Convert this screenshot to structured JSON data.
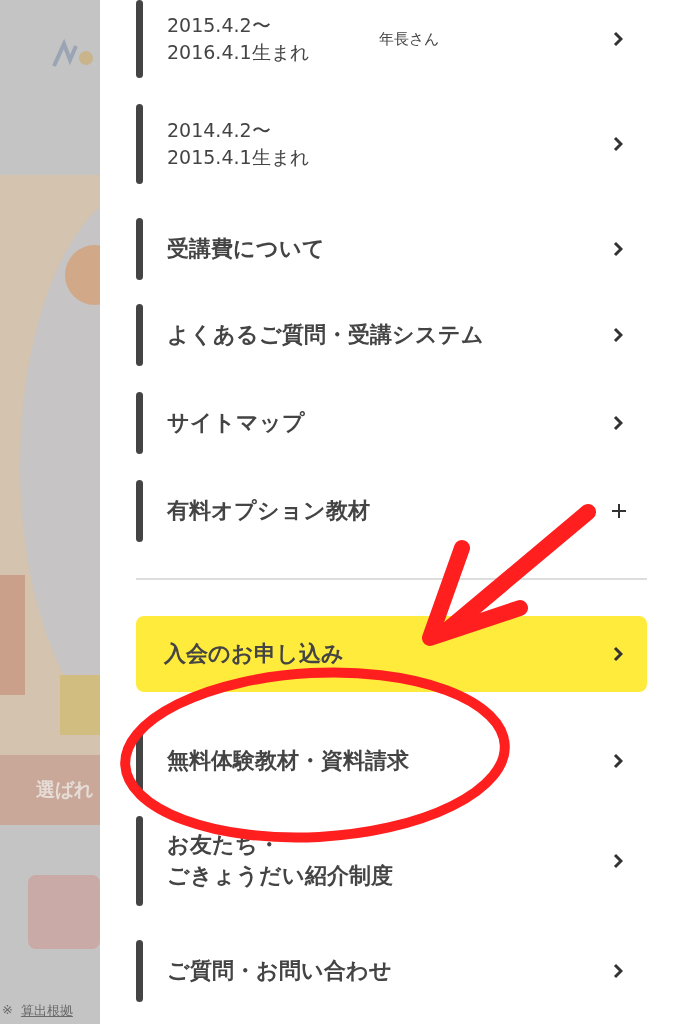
{
  "background": {
    "banner_text": "選ばれ",
    "footnote_mark": "※",
    "footnote_link": "算出根拠"
  },
  "menu": {
    "items": [
      {
        "kind": "link",
        "lines": [
          "2015.4.2〜",
          "2016.4.1生まれ"
        ],
        "note": "年長さん"
      },
      {
        "kind": "link",
        "lines": [
          "2014.4.2〜",
          "2015.4.1生まれ"
        ]
      },
      {
        "kind": "link",
        "lines": [
          "受講費について"
        ]
      },
      {
        "kind": "link",
        "lines": [
          "よくあるご質問・受講システム"
        ]
      },
      {
        "kind": "link",
        "lines": [
          "サイトマップ"
        ]
      },
      {
        "kind": "expand",
        "lines": [
          "有料オプション教材"
        ],
        "expanded": false
      },
      {
        "kind": "divider"
      },
      {
        "kind": "primary",
        "lines": [
          "入会のお申し込み"
        ]
      },
      {
        "kind": "link",
        "lines": [
          "無料体験教材・資料請求"
        ]
      },
      {
        "kind": "link",
        "lines": [
          "お友たち・",
          "ごきょうだい紹介制度"
        ]
      },
      {
        "kind": "link",
        "lines": [
          "ご質問・お問い合わせ"
        ]
      }
    ]
  }
}
